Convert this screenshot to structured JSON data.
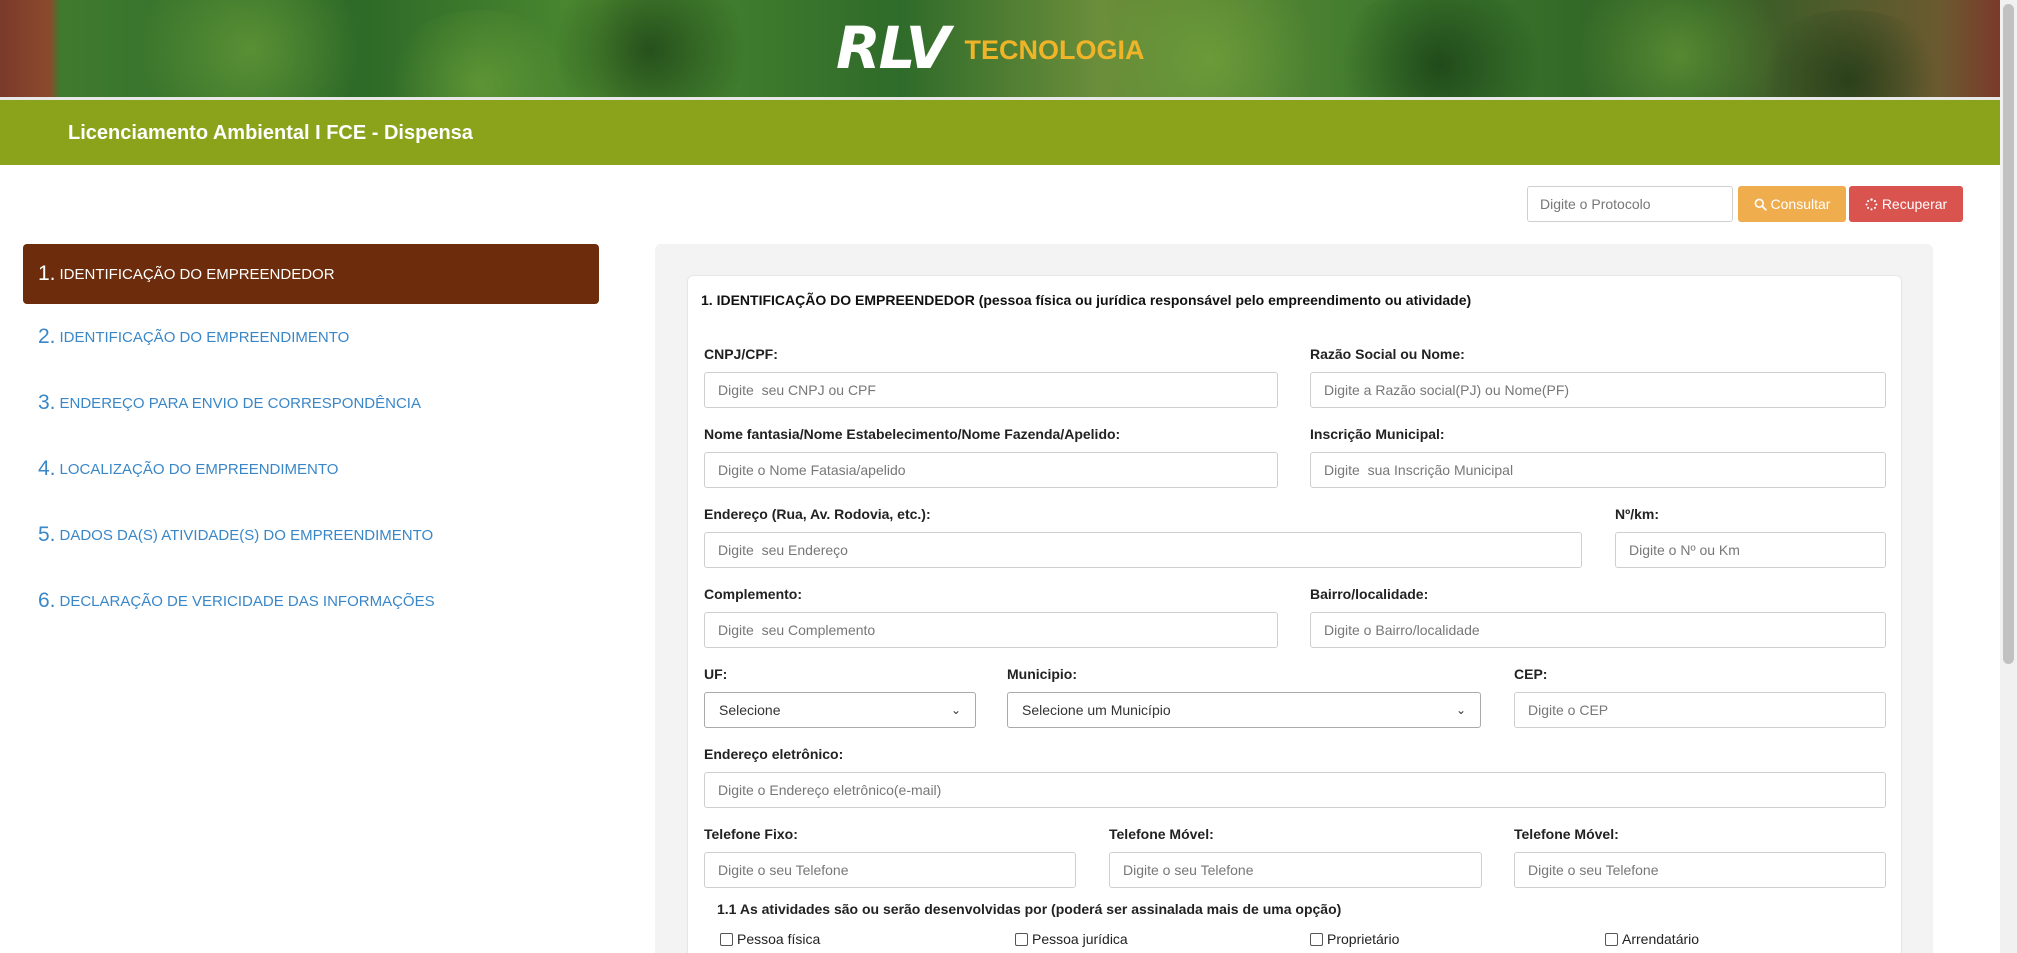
{
  "logo": {
    "mark": "RLV",
    "text": "TECNOLOGIA"
  },
  "header": {
    "title": "Licenciamento Ambiental I FCE - Dispensa"
  },
  "search": {
    "placeholder": "Digite o Protocolo",
    "consultar_label": "Consultar",
    "recuperar_label": "Recuperar"
  },
  "sidebar": {
    "items": [
      {
        "num": "1.",
        "label": "IDENTIFICAÇÃO DO EMPREENDEDOR"
      },
      {
        "num": "2.",
        "label": "IDENTIFICAÇÃO DO EMPREENDIMENTO"
      },
      {
        "num": "3.",
        "label": "ENDEREÇO PARA ENVIO DE CORRESPONDÊNCIA"
      },
      {
        "num": "4.",
        "label": "LOCALIZAÇÃO DO EMPREENDIMENTO"
      },
      {
        "num": "5.",
        "label": "DADOS DA(S) ATIVIDADE(S) DO EMPREENDIMENTO"
      },
      {
        "num": "6.",
        "label": "DECLARAÇÃO DE VERICIDADE DAS INFORMAÇÕES"
      }
    ]
  },
  "form": {
    "heading": "1. IDENTIFICAÇÃO DO EMPREENDEDOR (pessoa física ou jurídica responsável pelo empreendimento ou atividade)",
    "fields": {
      "cnpj": {
        "label": "CNPJ/CPF:",
        "placeholder": "Digite  seu CNPJ ou CPF"
      },
      "razao": {
        "label": "Razão Social ou Nome:",
        "placeholder": "Digite a Razão social(PJ) ou Nome(PF)"
      },
      "fantasia": {
        "label": "Nome fantasia/Nome Estabelecimento/Nome Fazenda/Apelido:",
        "placeholder": "Digite o Nome Fatasia/apelido"
      },
      "inscricao": {
        "label": "Inscrição Municipal:",
        "placeholder": "Digite  sua Inscrição Municipal"
      },
      "endereco": {
        "label": "Endereço (Rua, Av. Rodovia, etc.):",
        "placeholder": "Digite  seu Endereço"
      },
      "numero": {
        "label": "Nº/km:",
        "placeholder": "Digite o Nº ou Km"
      },
      "complemento": {
        "label": "Complemento:",
        "placeholder": "Digite  seu Complemento"
      },
      "bairro": {
        "label": "Bairro/localidade:",
        "placeholder": "Digite o Bairro/localidade"
      },
      "uf": {
        "label": "UF:",
        "selected": "Selecione"
      },
      "municipio": {
        "label": "Municipio:",
        "selected": "Selecione um Município"
      },
      "cep": {
        "label": "CEP:",
        "placeholder": "Digite o CEP"
      },
      "email": {
        "label": "Endereço eletrônico:",
        "placeholder": "Digite o Endereço eletrônico(e-mail)"
      },
      "telefone_fixo": {
        "label": "Telefone Fixo:",
        "placeholder": "Digite o seu Telefone"
      },
      "telefone_movel_1": {
        "label": "Telefone Móvel:",
        "placeholder": "Digite o seu Telefone"
      },
      "telefone_movel_2": {
        "label": "Telefone Móvel:",
        "placeholder": "Digite o seu Telefone"
      }
    },
    "activities": {
      "heading": "1.1 As atividades são ou serão desenvolvidas por (poderá ser assinalada mais de uma opção)",
      "options": [
        "Pessoa física",
        "Pessoa jurídica",
        "Proprietário",
        "Arrendatário"
      ]
    }
  },
  "colors": {
    "title_bar": "#8aa31a",
    "active_nav": "#6d2c0c",
    "nav_link": "#3a87c8",
    "consultar": "#f0ad4e",
    "recuperar": "#d9534f",
    "logo_accent": "#f0b429"
  },
  "icons": {
    "consultar": "search-icon",
    "recuperar": "spinner-icon",
    "select": "chevron-down-icon"
  }
}
